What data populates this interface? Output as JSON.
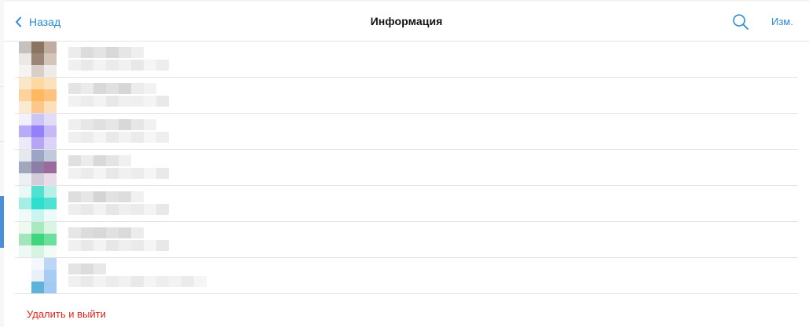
{
  "header": {
    "back_label": "Назад",
    "title": "Информация",
    "edit_label": "Изм."
  },
  "members": [
    {
      "avatar_colors": [
        "#c7c1bd",
        "#8c7463",
        "#c0aca0",
        "#ece8e5",
        "#9a8576",
        "#d4c5bb",
        "#f6f3f1",
        "#d9cfc9",
        "#efebe8"
      ]
    },
    {
      "avatar_colors": [
        "#fbe6c8",
        "#fdd8a0",
        "#fbe2bd",
        "#fcd39c",
        "#ffb85f",
        "#fdc27d",
        "#fbe9d2",
        "#fcc78a",
        "#fde0bb"
      ]
    },
    {
      "avatar_colors": [
        "#f2f0fb",
        "#cbc4f4",
        "#e2dcf8",
        "#b8abf8",
        "#9480f9",
        "#c6b9f5",
        "#eceafa",
        "#b7a5f4",
        "#dcd3f8"
      ]
    },
    {
      "avatar_colors": [
        "#e6e8ee",
        "#9aa6c4",
        "#c1c9dc",
        "#a1a8bc",
        "#8e7ea6",
        "#9b6b9c",
        "#eceff3",
        "#d5ccd9",
        "#e8dce8"
      ]
    },
    {
      "avatar_colors": [
        "#e8f9f6",
        "#52e0d0",
        "#b7f0e9",
        "#a6ede3",
        "#2fdfcd",
        "#4fe2d2",
        "#eefbf9",
        "#c9f4ef",
        "#eafbf8"
      ]
    },
    {
      "avatar_colors": [
        "#edf9f1",
        "#a9e9c0",
        "#d9f5e3",
        "#a4e6bc",
        "#3fd57e",
        "#6ddf9d",
        "#eef9f3",
        "#d6f4e1",
        "#f2fbf5"
      ]
    },
    {
      "avatar_colors": [
        "#ffffff",
        "#f4f7fb",
        "#bcd6f6",
        "#ffffff",
        "#e8f0fa",
        "#a8cdf4",
        "#ffffff",
        "#5fb3d8",
        "#a2cbf3"
      ]
    }
  ],
  "blur_colors": {
    "name": [
      [
        "#ececec",
        "#dcdcdc",
        "#e4e4e4",
        "#d8d8d8",
        "#e6e6e6",
        "#efefef"
      ],
      [
        "#e4e4e4",
        "#ebebeb",
        "#d9d9d9",
        "#e0e0e0",
        "#d6d6d6",
        "#ececec",
        "#f2f2f2"
      ],
      [
        "#efefef",
        "#e7e7e7",
        "#e0e0e0",
        "#e6e6e6",
        "#d8d8d8",
        "#e6e6e6",
        "#f1f1f1"
      ],
      [
        "#e0e0e0",
        "#ececec",
        "#d9d9d9",
        "#e4e4e4",
        "#f0f0f0"
      ],
      [
        "#dedede",
        "#e6e6e6",
        "#d4d4d4",
        "#e2e2e2",
        "#dddddd",
        "#f0f0f0"
      ],
      [
        "#e6e6e6",
        "#dcdcdc",
        "#d8d8d8",
        "#e1e1e1",
        "#dadada",
        "#ececec"
      ],
      [
        "#e4e4e4",
        "#dcdcdc",
        "#e8e8e8"
      ]
    ],
    "status": [
      [
        "#f0f0f0",
        "#e9e9e9",
        "#f3f3f3",
        "#ebebeb",
        "#f1f1f1",
        "#e8e8e8",
        "#f5f5f5",
        "#ededed"
      ],
      [
        "#f1f1f1",
        "#ececec",
        "#f3f3f3",
        "#e8e8e8",
        "#f0f0f0",
        "#efefef",
        "#f4f4f4",
        "#e9e9e9"
      ],
      [
        "#f0f0f0",
        "#ececec",
        "#f4f4f4",
        "#e9e9e9",
        "#f2f2f2",
        "#ebebeb",
        "#f6f6f6",
        "#eeeeee"
      ],
      [
        "#f1f1f1",
        "#ebebeb",
        "#f4f4f4",
        "#e8e8e8",
        "#f0f0f0",
        "#ececec",
        "#f5f5f5",
        "#e9e9e9"
      ],
      [
        "#eeeeee",
        "#e9e9e9",
        "#f2f2f2",
        "#e6e6e6",
        "#efefef",
        "#ebebeb",
        "#f4f4f4",
        "#e8e8e8"
      ],
      [
        "#f0f0f0",
        "#e8e8e8",
        "#f3f3f3",
        "#e7e7e7",
        "#efefef",
        "#eaeaea",
        "#f5f5f5",
        "#e8e8e8"
      ],
      [
        "#f0f0f0",
        "#eaeaea",
        "#f3f3f3",
        "#ececec",
        "#f1f1f1",
        "#e9e9e9",
        "#f4f4f4",
        "#eeeeee",
        "#f2f2f2",
        "#ebebeb",
        "#f5f5f5"
      ]
    ]
  },
  "footer": {
    "leave_label": "Удалить и выйти"
  },
  "colors": {
    "accent": "#2b8ad6",
    "danger": "#e0271f",
    "separator": "#e4e4e4"
  },
  "icons": {
    "back": "chevron-left-icon",
    "search": "search-icon"
  }
}
